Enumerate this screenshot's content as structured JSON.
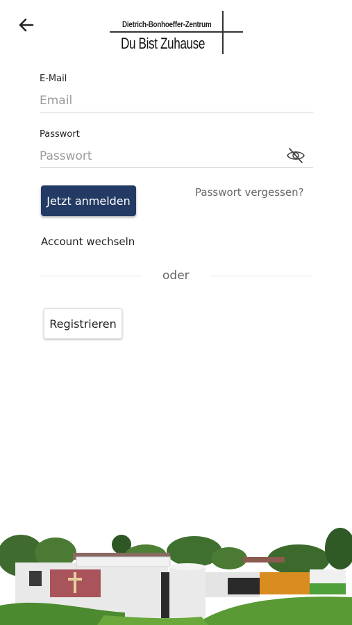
{
  "header": {
    "back_icon": "arrow-left-icon",
    "logo": {
      "line1": "Dietrich-Bonhoeffer-Zentrum",
      "line2": "Du Bist Zuhause"
    }
  },
  "form": {
    "email": {
      "label": "E-Mail",
      "placeholder": "Email",
      "value": ""
    },
    "password": {
      "label": "Passwort",
      "placeholder": "Passwort",
      "value": "",
      "toggle_icon": "eye-off-icon"
    }
  },
  "actions": {
    "login_label": "Jetzt anmelden",
    "forgot_label": "Passwort vergessen?",
    "switch_account_label": "Account wechseln",
    "separator_label": "oder",
    "register_label": "Registrieren"
  },
  "colors": {
    "primary_button": "#233a64",
    "background": "#ffffff"
  }
}
